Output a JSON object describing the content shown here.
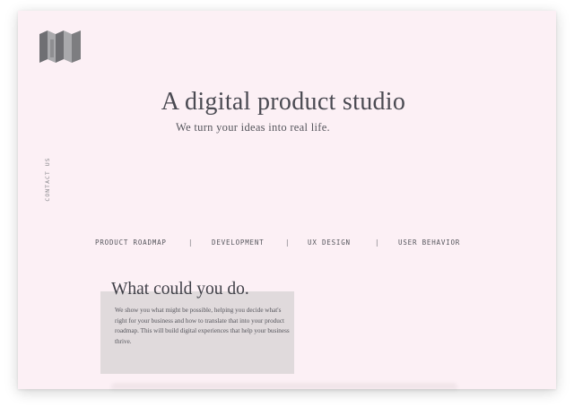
{
  "hero": {
    "title": "A digital product studio",
    "subtitle": "We turn your ideas into real life."
  },
  "sidebar": {
    "contact_label": "CONTACT US"
  },
  "services": {
    "items": [
      "PRODUCT ROADMAP",
      "DEVELOPMENT",
      "UX DESIGN",
      "USER BEHAVIOR"
    ],
    "separator": "|"
  },
  "feature": {
    "title": "What could you do.",
    "body": "We show you what might be possible, helping you decide what's right for your business and how to translate that into your product roadmap. This will build digital experiences that help your business thrive."
  },
  "logo": {
    "icon": "folded-map-logo"
  },
  "colors": {
    "page_bg": "#fcf0f5",
    "feature_box": "#e0dadc",
    "text_dark": "#4a4a52",
    "logo_gray": "#7d7d80"
  }
}
